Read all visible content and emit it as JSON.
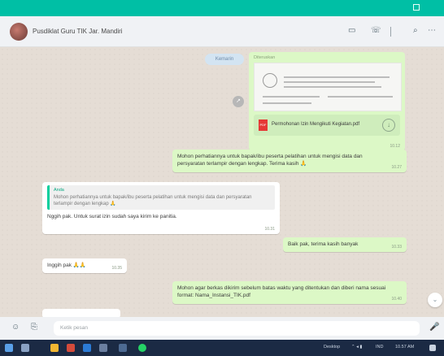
{
  "header": {
    "chat_name": "Pusdiklat Guru TIK Jar. Mandiri",
    "icons": [
      "video-call-icon",
      "call-icon",
      "search-icon",
      "more-icon"
    ]
  },
  "messages": {
    "date_pill": "Kemarin",
    "forward_label": "Diteruskan",
    "file_name": "Permohonan Izin Mengikuti Kegiatan.pdf",
    "file_time": "10.12",
    "msg2_text": "Mohon perhatiannya untuk bapak/ibu peserta pelatihan untuk mengisi data dan persyaratan terlampir dengan lengkap. Terima kasih 🙏",
    "msg2_time": "10.27",
    "quote_name": "Anda",
    "quote_text": "Mohon perhatiannya untuk bapak/ibu peserta pelatihan untuk mengisi data dan persyaratan terlampir dengan lengkap 🙏",
    "reply_text": "Nggih pak. Untuk surat izin sudah saya kirim ke panitia.",
    "reply_time": "10.31",
    "msg3_text": "Baik pak, terima kasih banyak",
    "msg3_time": "10.33",
    "msg4_text": "Inggih pak 🙏🙏",
    "msg4_time": "10.35",
    "msg5_text": "Mohon agar berkas dikirim sebelum batas waktu yang ditentukan dan diberi nama sesuai format: Nama_Instansi_TIK.pdf",
    "msg5_time": "10.40",
    "partial_text": "",
    "partial_time": ""
  },
  "composer": {
    "placeholder": "Ketik pesan"
  },
  "taskbar": {
    "tray_text": "Desktop",
    "lang": "IND",
    "clock": "10.57 AM"
  }
}
